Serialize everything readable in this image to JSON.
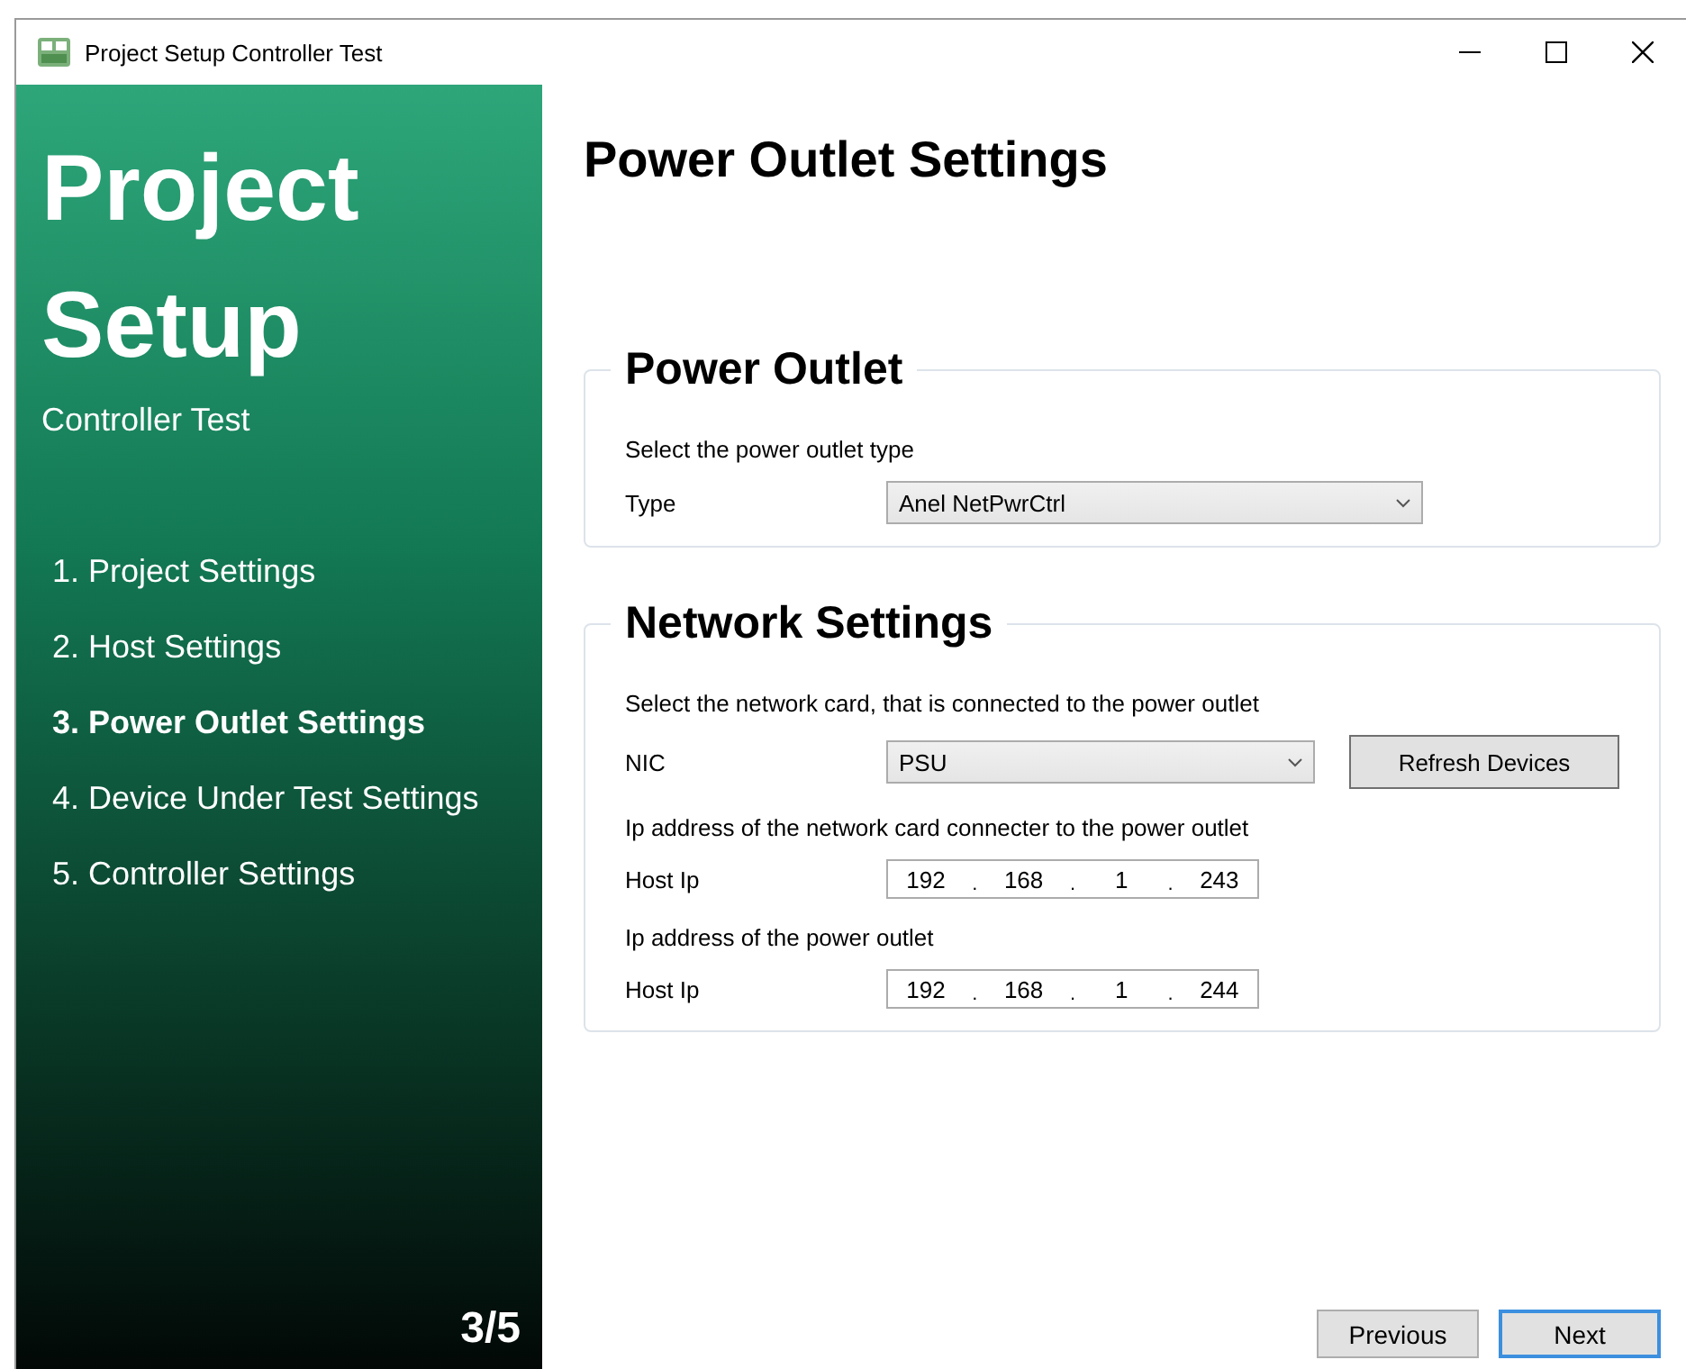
{
  "window": {
    "title": "Project Setup Controller Test"
  },
  "sidebar": {
    "title_lines": [
      "Project",
      "Setup"
    ],
    "subtitle": "Controller Test",
    "steps": [
      {
        "label": "1. Project Settings",
        "selected": false
      },
      {
        "label": "2. Host Settings",
        "selected": false
      },
      {
        "label": "3. Power Outlet Settings",
        "selected": true
      },
      {
        "label": "4. Device Under Test Settings",
        "selected": false
      },
      {
        "label": "5. Controller Settings",
        "selected": false
      }
    ],
    "progress": "3/5"
  },
  "page_title": "Power Outlet Settings",
  "groups": [
    {
      "title": "Power Outlet",
      "rows": [
        {
          "kind": "note",
          "text": "Select the power outlet type"
        },
        {
          "kind": "combo",
          "label": "Type",
          "value": "Anel NetPwrCtrl"
        }
      ]
    },
    {
      "title": "Network Settings",
      "rows": [
        {
          "kind": "note",
          "text": "Select the network card, that is connected to the power outlet"
        },
        {
          "kind": "combo",
          "label": "NIC",
          "value": "PSU",
          "button": "Refresh Devices"
        },
        {
          "kind": "note",
          "text": "Ip address of the network card connecter to the power outlet"
        },
        {
          "kind": "ip",
          "label": "Host Ip",
          "octets": [
            "192",
            "168",
            "1",
            "243"
          ],
          "separator": "."
        },
        {
          "kind": "note",
          "text": "Ip address of the power outlet"
        },
        {
          "kind": "ip",
          "label": "Host Ip",
          "octets": [
            "192",
            "168",
            "1",
            "244"
          ],
          "separator": "."
        }
      ]
    }
  ],
  "buttons": [
    {
      "label": "Previous",
      "focused": false
    },
    {
      "label": "Next",
      "focused": true
    }
  ]
}
